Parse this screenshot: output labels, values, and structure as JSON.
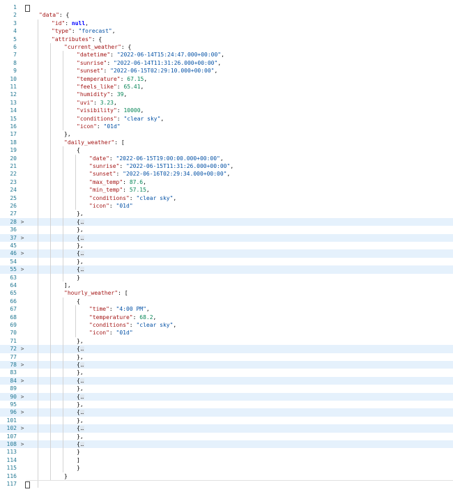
{
  "editor": {
    "lines": [
      {
        "n": "1",
        "fold": "",
        "t": [
          {
            "c": "",
            "x": ""
          }
        ]
      },
      {
        "n": "2",
        "fold": "",
        "t": [
          {
            "c": "k",
            "x": "\"data\""
          },
          {
            "c": "p",
            "x": ": {"
          }
        ]
      },
      {
        "n": "3",
        "fold": "",
        "t": [
          {
            "c": "k",
            "x": "\"id\""
          },
          {
            "c": "p",
            "x": ": "
          },
          {
            "c": "b",
            "x": "null"
          },
          {
            "c": "p",
            "x": ","
          }
        ]
      },
      {
        "n": "4",
        "fold": "",
        "t": [
          {
            "c": "k",
            "x": "\"type\""
          },
          {
            "c": "p",
            "x": ": "
          },
          {
            "c": "s",
            "x": "\"forecast\""
          },
          {
            "c": "p",
            "x": ","
          }
        ]
      },
      {
        "n": "5",
        "fold": "",
        "t": [
          {
            "c": "k",
            "x": "\"attributes\""
          },
          {
            "c": "p",
            "x": ": {"
          }
        ]
      },
      {
        "n": "6",
        "fold": "",
        "t": [
          {
            "c": "k",
            "x": "\"current_weather\""
          },
          {
            "c": "p",
            "x": ": {"
          }
        ]
      },
      {
        "n": "7",
        "fold": "",
        "t": [
          {
            "c": "k",
            "x": "\"datetime\""
          },
          {
            "c": "p",
            "x": ": "
          },
          {
            "c": "s",
            "x": "\"2022-06-14T15:24:47.000+00:00\""
          },
          {
            "c": "p",
            "x": ","
          }
        ]
      },
      {
        "n": "8",
        "fold": "",
        "t": [
          {
            "c": "k",
            "x": "\"sunrise\""
          },
          {
            "c": "p",
            "x": ": "
          },
          {
            "c": "s",
            "x": "\"2022-06-14T11:31:26.000+00:00\""
          },
          {
            "c": "p",
            "x": ","
          }
        ]
      },
      {
        "n": "9",
        "fold": "",
        "t": [
          {
            "c": "k",
            "x": "\"sunset\""
          },
          {
            "c": "p",
            "x": ": "
          },
          {
            "c": "s",
            "x": "\"2022-06-15T02:29:10.000+00:00\""
          },
          {
            "c": "p",
            "x": ","
          }
        ]
      },
      {
        "n": "10",
        "fold": "",
        "t": [
          {
            "c": "k",
            "x": "\"temperature\""
          },
          {
            "c": "p",
            "x": ": "
          },
          {
            "c": "n",
            "x": "67.15"
          },
          {
            "c": "p",
            "x": ","
          }
        ]
      },
      {
        "n": "11",
        "fold": "",
        "t": [
          {
            "c": "k",
            "x": "\"feels_like\""
          },
          {
            "c": "p",
            "x": ": "
          },
          {
            "c": "n",
            "x": "65.41"
          },
          {
            "c": "p",
            "x": ","
          }
        ]
      },
      {
        "n": "12",
        "fold": "",
        "t": [
          {
            "c": "k",
            "x": "\"humidity\""
          },
          {
            "c": "p",
            "x": ": "
          },
          {
            "c": "n",
            "x": "39"
          },
          {
            "c": "p",
            "x": ","
          }
        ]
      },
      {
        "n": "13",
        "fold": "",
        "t": [
          {
            "c": "k",
            "x": "\"uvi\""
          },
          {
            "c": "p",
            "x": ": "
          },
          {
            "c": "n",
            "x": "3.23"
          },
          {
            "c": "p",
            "x": ","
          }
        ]
      },
      {
        "n": "14",
        "fold": "",
        "t": [
          {
            "c": "k",
            "x": "\"visibility\""
          },
          {
            "c": "p",
            "x": ": "
          },
          {
            "c": "n",
            "x": "10000"
          },
          {
            "c": "p",
            "x": ","
          }
        ]
      },
      {
        "n": "15",
        "fold": "",
        "t": [
          {
            "c": "k",
            "x": "\"conditions\""
          },
          {
            "c": "p",
            "x": ": "
          },
          {
            "c": "s",
            "x": "\"clear sky\""
          },
          {
            "c": "p",
            "x": ","
          }
        ]
      },
      {
        "n": "16",
        "fold": "",
        "t": [
          {
            "c": "k",
            "x": "\"icon\""
          },
          {
            "c": "p",
            "x": ": "
          },
          {
            "c": "s",
            "x": "\"01d\""
          }
        ]
      },
      {
        "n": "17",
        "fold": "",
        "t": [
          {
            "c": "p",
            "x": "},"
          }
        ]
      },
      {
        "n": "18",
        "fold": "",
        "t": [
          {
            "c": "k",
            "x": "\"daily_weather\""
          },
          {
            "c": "p",
            "x": ": ["
          }
        ]
      },
      {
        "n": "19",
        "fold": "",
        "t": [
          {
            "c": "p",
            "x": "{"
          }
        ]
      },
      {
        "n": "20",
        "fold": "",
        "t": [
          {
            "c": "k",
            "x": "\"date\""
          },
          {
            "c": "p",
            "x": ": "
          },
          {
            "c": "s",
            "x": "\"2022-06-15T19:00:00.000+00:00\""
          },
          {
            "c": "p",
            "x": ","
          }
        ]
      },
      {
        "n": "21",
        "fold": "",
        "t": [
          {
            "c": "k",
            "x": "\"sunrise\""
          },
          {
            "c": "p",
            "x": ": "
          },
          {
            "c": "s",
            "x": "\"2022-06-15T11:31:26.000+00:00\""
          },
          {
            "c": "p",
            "x": ","
          }
        ]
      },
      {
        "n": "22",
        "fold": "",
        "t": [
          {
            "c": "k",
            "x": "\"sunset\""
          },
          {
            "c": "p",
            "x": ": "
          },
          {
            "c": "s",
            "x": "\"2022-06-16T02:29:34.000+00:00\""
          },
          {
            "c": "p",
            "x": ","
          }
        ]
      },
      {
        "n": "23",
        "fold": "",
        "t": [
          {
            "c": "k",
            "x": "\"max_temp\""
          },
          {
            "c": "p",
            "x": ": "
          },
          {
            "c": "n",
            "x": "87.6"
          },
          {
            "c": "p",
            "x": ","
          }
        ]
      },
      {
        "n": "24",
        "fold": "",
        "t": [
          {
            "c": "k",
            "x": "\"min_temp\""
          },
          {
            "c": "p",
            "x": ": "
          },
          {
            "c": "n",
            "x": "57.15"
          },
          {
            "c": "p",
            "x": ","
          }
        ]
      },
      {
        "n": "25",
        "fold": "",
        "t": [
          {
            "c": "k",
            "x": "\"conditions\""
          },
          {
            "c": "p",
            "x": ": "
          },
          {
            "c": "s",
            "x": "\"clear sky\""
          },
          {
            "c": "p",
            "x": ","
          }
        ]
      },
      {
        "n": "26",
        "fold": "",
        "t": [
          {
            "c": "k",
            "x": "\"icon\""
          },
          {
            "c": "p",
            "x": ": "
          },
          {
            "c": "s",
            "x": "\"01d\""
          }
        ]
      },
      {
        "n": "27",
        "fold": "",
        "t": [
          {
            "c": "p",
            "x": "},"
          }
        ]
      },
      {
        "n": "28",
        "fold": ">",
        "t": [
          {
            "c": "p",
            "x": "{"
          },
          {
            "c": "dots",
            "x": "…"
          }
        ]
      },
      {
        "n": "36",
        "fold": "",
        "t": [
          {
            "c": "p",
            "x": "},"
          }
        ]
      },
      {
        "n": "37",
        "fold": ">",
        "t": [
          {
            "c": "p",
            "x": "{"
          },
          {
            "c": "dots",
            "x": "…"
          }
        ]
      },
      {
        "n": "45",
        "fold": "",
        "t": [
          {
            "c": "p",
            "x": "},"
          }
        ]
      },
      {
        "n": "46",
        "fold": ">",
        "t": [
          {
            "c": "p",
            "x": "{"
          },
          {
            "c": "dots",
            "x": "…"
          }
        ]
      },
      {
        "n": "54",
        "fold": "",
        "t": [
          {
            "c": "p",
            "x": "},"
          }
        ]
      },
      {
        "n": "55",
        "fold": ">",
        "t": [
          {
            "c": "p",
            "x": "{"
          },
          {
            "c": "dots",
            "x": "…"
          }
        ]
      },
      {
        "n": "63",
        "fold": "",
        "t": [
          {
            "c": "p",
            "x": "}"
          }
        ]
      },
      {
        "n": "64",
        "fold": "",
        "t": [
          {
            "c": "p",
            "x": "],"
          }
        ]
      },
      {
        "n": "65",
        "fold": "",
        "t": [
          {
            "c": "k",
            "x": "\"hourly_weather\""
          },
          {
            "c": "p",
            "x": ": ["
          }
        ]
      },
      {
        "n": "66",
        "fold": "",
        "t": [
          {
            "c": "p",
            "x": "{"
          }
        ]
      },
      {
        "n": "67",
        "fold": "",
        "t": [
          {
            "c": "k",
            "x": "\"time\""
          },
          {
            "c": "p",
            "x": ": "
          },
          {
            "c": "s",
            "x": "\"4:00 PM\""
          },
          {
            "c": "p",
            "x": ","
          }
        ]
      },
      {
        "n": "68",
        "fold": "",
        "t": [
          {
            "c": "k",
            "x": "\"temperature\""
          },
          {
            "c": "p",
            "x": ": "
          },
          {
            "c": "n",
            "x": "68.2"
          },
          {
            "c": "p",
            "x": ","
          }
        ]
      },
      {
        "n": "69",
        "fold": "",
        "t": [
          {
            "c": "k",
            "x": "\"conditions\""
          },
          {
            "c": "p",
            "x": ": "
          },
          {
            "c": "s",
            "x": "\"clear sky\""
          },
          {
            "c": "p",
            "x": ","
          }
        ]
      },
      {
        "n": "70",
        "fold": "",
        "t": [
          {
            "c": "k",
            "x": "\"icon\""
          },
          {
            "c": "p",
            "x": ": "
          },
          {
            "c": "s",
            "x": "\"01d\""
          }
        ]
      },
      {
        "n": "71",
        "fold": "",
        "t": [
          {
            "c": "p",
            "x": "},"
          }
        ]
      },
      {
        "n": "72",
        "fold": ">",
        "t": [
          {
            "c": "p",
            "x": "{"
          },
          {
            "c": "dots",
            "x": "…"
          }
        ]
      },
      {
        "n": "77",
        "fold": "",
        "t": [
          {
            "c": "p",
            "x": "},"
          }
        ]
      },
      {
        "n": "78",
        "fold": ">",
        "t": [
          {
            "c": "p",
            "x": "{"
          },
          {
            "c": "dots",
            "x": "…"
          }
        ]
      },
      {
        "n": "83",
        "fold": "",
        "t": [
          {
            "c": "p",
            "x": "},"
          }
        ]
      },
      {
        "n": "84",
        "fold": ">",
        "t": [
          {
            "c": "p",
            "x": "{"
          },
          {
            "c": "dots",
            "x": "…"
          }
        ]
      },
      {
        "n": "89",
        "fold": "",
        "t": [
          {
            "c": "p",
            "x": "},"
          }
        ]
      },
      {
        "n": "90",
        "fold": ">",
        "t": [
          {
            "c": "p",
            "x": "{"
          },
          {
            "c": "dots",
            "x": "…"
          }
        ]
      },
      {
        "n": "95",
        "fold": "",
        "t": [
          {
            "c": "p",
            "x": "},"
          }
        ]
      },
      {
        "n": "96",
        "fold": ">",
        "t": [
          {
            "c": "p",
            "x": "{"
          },
          {
            "c": "dots",
            "x": "…"
          }
        ]
      },
      {
        "n": "101",
        "fold": "",
        "t": [
          {
            "c": "p",
            "x": "},"
          }
        ]
      },
      {
        "n": "102",
        "fold": ">",
        "t": [
          {
            "c": "p",
            "x": "{"
          },
          {
            "c": "dots",
            "x": "…"
          }
        ]
      },
      {
        "n": "107",
        "fold": "",
        "t": [
          {
            "c": "p",
            "x": "},"
          }
        ]
      },
      {
        "n": "108",
        "fold": ">",
        "t": [
          {
            "c": "p",
            "x": "{"
          },
          {
            "c": "dots",
            "x": "…"
          }
        ]
      },
      {
        "n": "113",
        "fold": "",
        "t": [
          {
            "c": "p",
            "x": "}"
          }
        ]
      },
      {
        "n": "114",
        "fold": "",
        "t": [
          {
            "c": "p",
            "x": "]"
          }
        ]
      },
      {
        "n": "115",
        "fold": "",
        "t": [
          {
            "c": "p",
            "x": "}"
          }
        ]
      },
      {
        "n": "116",
        "fold": "",
        "t": [
          {
            "c": "p",
            "x": "}"
          }
        ]
      },
      {
        "n": "117",
        "fold": "",
        "t": [
          {
            "c": "",
            "x": ""
          }
        ]
      }
    ]
  },
  "colors": {
    "line_number": "#237893",
    "json_key": "#a31515",
    "json_string": "#0451a5",
    "json_number": "#098658",
    "json_literal": "#0000ff",
    "folded_highlight": "#e5f1fc"
  },
  "icons": {
    "fold_collapsed": "chevron-right-icon"
  }
}
